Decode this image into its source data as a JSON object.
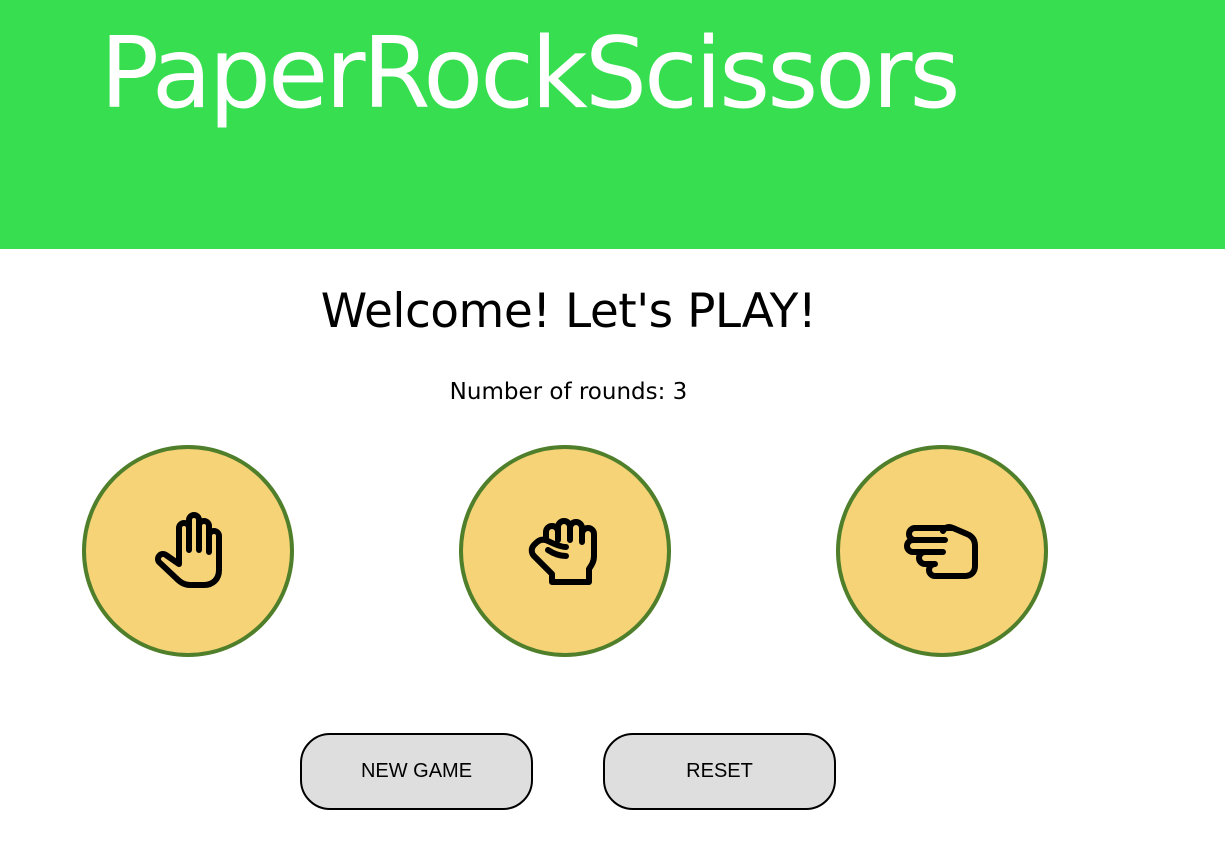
{
  "header": {
    "title": "PaperRockScissors",
    "background_color": "#37df50",
    "title_color": "#ffffff"
  },
  "main": {
    "welcome": "Welcome! Let's PLAY!",
    "rounds_label": "Number of rounds: 3",
    "choices": [
      {
        "id": "paper",
        "icon": "hand-paper-icon"
      },
      {
        "id": "rock",
        "icon": "hand-rock-icon"
      },
      {
        "id": "scissors",
        "icon": "hand-scissors-icon"
      }
    ],
    "choice_fill_color": "#f7d378",
    "choice_border_color": "#4f7f2a"
  },
  "buttons": {
    "new_game_label": "NEW GAME",
    "reset_label": "RESET",
    "background_color": "#dedede"
  }
}
